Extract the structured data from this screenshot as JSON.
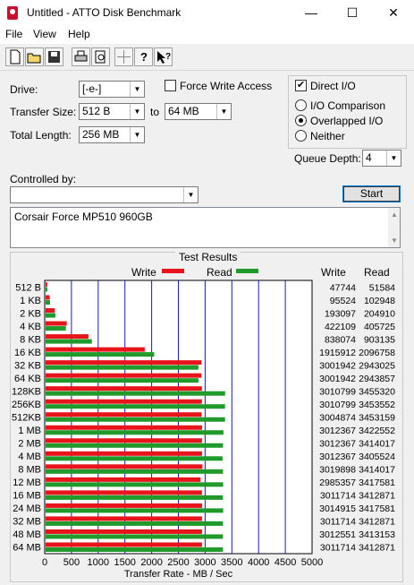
{
  "window": {
    "title": "Untitled - ATTO Disk Benchmark",
    "minimize": "—",
    "maximize": "☐",
    "close": "✕"
  },
  "menu": [
    "File",
    "View",
    "Help"
  ],
  "toolbar_icons": [
    "new-file-icon",
    "open-folder-icon",
    "save-icon",
    "print-icon",
    "print-preview-icon",
    "move-icon",
    "help-icon",
    "context-help-icon"
  ],
  "form": {
    "drive_label": "Drive:",
    "drive_value": "[-e-]",
    "transfer_size_label": "Transfer Size:",
    "transfer_from": "512 B",
    "to_label": "to",
    "transfer_to": "64 MB",
    "total_length_label": "Total Length:",
    "total_length_value": "256 MB",
    "force_write_label": "Force Write Access",
    "force_write_checked": false,
    "direct_io_label": "Direct I/O",
    "direct_io_checked": true,
    "io_comparison_label": "I/O Comparison",
    "overlapped_io_label": "Overlapped I/O",
    "neither_label": "Neither",
    "selected_io_mode": "Overlapped I/O",
    "queue_depth_label": "Queue Depth:",
    "queue_depth_value": "4",
    "controlled_by_label": "Controlled by:",
    "controlled_by_value": "",
    "start_label": "Start",
    "description": "Corsair Force MP510 960GB"
  },
  "results": {
    "title": "Test Results",
    "legend_write": "Write",
    "legend_read": "Read",
    "col_write": "Write",
    "col_read": "Read",
    "write_color": "#e8141c",
    "read_color": "#1f9a2b"
  },
  "chart_data": {
    "type": "bar",
    "orientation": "horizontal",
    "xlabel": "Transfer Rate - MB / Sec",
    "xlim": [
      0,
      5000
    ],
    "xticks": [
      0,
      500,
      1000,
      1500,
      2000,
      2500,
      3000,
      3500,
      4000,
      4500,
      5000
    ],
    "categories": [
      "512 B",
      "1 KB",
      "2 KB",
      "4 KB",
      "8 KB",
      "16 KB",
      "32 KB",
      "64 KB",
      "128KB",
      "256KB",
      "512KB",
      "1 MB",
      "2 MB",
      "4 MB",
      "8 MB",
      "12 MB",
      "16 MB",
      "24 MB",
      "32 MB",
      "48 MB",
      "64 MB"
    ],
    "series": [
      {
        "name": "Write",
        "values_kb": [
          47744,
          95524,
          193097,
          422109,
          838074,
          1915912,
          3001942,
          3001942,
          3010799,
          3010799,
          3004874,
          3012367,
          3012367,
          3012367,
          3019898,
          2985357,
          3011714,
          3014915,
          3011714,
          3012551,
          3011714
        ]
      },
      {
        "name": "Read",
        "values_kb": [
          51584,
          102948,
          204910,
          405725,
          903135,
          2096758,
          2943025,
          2943857,
          3455320,
          3453552,
          3453159,
          3422552,
          3414017,
          3405524,
          3414017,
          3417581,
          3412871,
          3417581,
          3412871,
          3413153,
          3412871
        ]
      }
    ]
  }
}
